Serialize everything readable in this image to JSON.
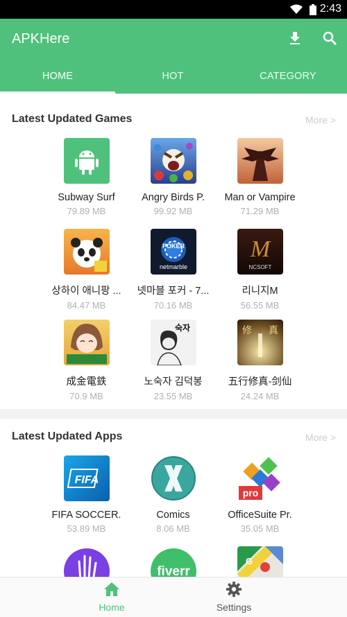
{
  "status": {
    "time": "2:43"
  },
  "appbar": {
    "title": "APKHere"
  },
  "tabs": [
    {
      "label": "HOME"
    },
    {
      "label": "HOT"
    },
    {
      "label": "CATEGORY"
    }
  ],
  "games": {
    "title": "Latest Updated Games",
    "more": "More >",
    "items": [
      {
        "name": "Subway Surf",
        "size": "79.89 MB",
        "icon": "android-icon"
      },
      {
        "name": "Angry Birds P.",
        "size": "99.92 MB",
        "icon": "angry-birds-icon"
      },
      {
        "name": "Man or Vampire",
        "size": "71.29 MB",
        "icon": "vampire-icon"
      },
      {
        "name": "상하이 애니팡 ...",
        "size": "84.47 MB",
        "icon": "panda-icon"
      },
      {
        "name": "넷마블 포커 - 7...",
        "size": "70.16 MB",
        "icon": "poker-icon"
      },
      {
        "name": "리니지M",
        "size": "56.55 MB",
        "icon": "lineage-icon"
      },
      {
        "name": "成金電鉄",
        "size": "70.9 MB",
        "icon": "anime-girl-icon"
      },
      {
        "name": "노숙자 김덕봉",
        "size": "23.55 MB",
        "icon": "sketch-man-icon"
      },
      {
        "name": "五行修真-剑仙",
        "size": "24.24 MB",
        "icon": "xiuzhen-icon"
      }
    ]
  },
  "apps": {
    "title": "Latest Updated Apps",
    "more": "More >",
    "items": [
      {
        "name": "FIFA SOCCER.",
        "size": "53.89 MB",
        "icon": "fifa-icon"
      },
      {
        "name": "Comics",
        "size": "8.06 MB",
        "icon": "comics-icon"
      },
      {
        "name": "OfficeSuite Pr.",
        "size": "35.05 MB",
        "icon": "officesuite-icon"
      },
      {
        "name": "",
        "size": "",
        "icon": "hand-icon"
      },
      {
        "name": "",
        "size": "",
        "icon": "fiverr-icon"
      },
      {
        "name": "",
        "size": "",
        "icon": "maps-icon"
      }
    ],
    "partial_texts": {
      "fiverr": "fiverr",
      "fifa": "FIFA",
      "pro": "pro",
      "poker": "POKER",
      "netmarble": "netmarble",
      "ncsoft": "NCSOFT",
      "m": "M",
      "xiu": "修",
      "zhen": "真",
      "suk": "숙자",
      "G": "G"
    }
  },
  "bottomnav": [
    {
      "label": "Home",
      "icon": "home-icon",
      "color": "#4fc17c"
    },
    {
      "label": "Settings",
      "icon": "gear-icon",
      "color": "#555555"
    }
  ],
  "colors": {
    "accent": "#4fc17c"
  }
}
